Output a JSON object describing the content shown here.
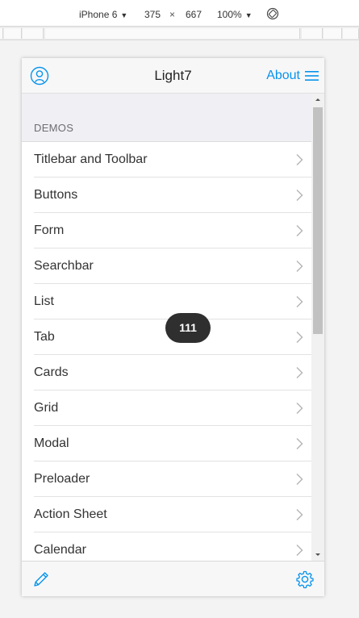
{
  "devtools": {
    "device": "iPhone 6",
    "width": "375",
    "times": "×",
    "height": "667",
    "zoom": "100%"
  },
  "navbar": {
    "title": "Light7",
    "about_label": "About"
  },
  "section": {
    "title": "DEMOS"
  },
  "items": [
    {
      "label": "Titlebar and Toolbar"
    },
    {
      "label": "Buttons"
    },
    {
      "label": "Form"
    },
    {
      "label": "Searchbar"
    },
    {
      "label": "List"
    },
    {
      "label": "Tab"
    },
    {
      "label": "Cards"
    },
    {
      "label": "Grid"
    },
    {
      "label": "Modal"
    },
    {
      "label": "Preloader"
    },
    {
      "label": "Action Sheet"
    },
    {
      "label": "Calendar"
    }
  ],
  "toast": {
    "text": "111"
  },
  "colors": {
    "accent": "#0894ec",
    "toast_bg": "#2f2f2f"
  },
  "icons": {
    "nav_left": "user-icon",
    "nav_right": "menu-icon",
    "item_arrow": "chevron-right-icon",
    "toolbar_left": "edit-icon",
    "toolbar_right": "gear-icon"
  }
}
